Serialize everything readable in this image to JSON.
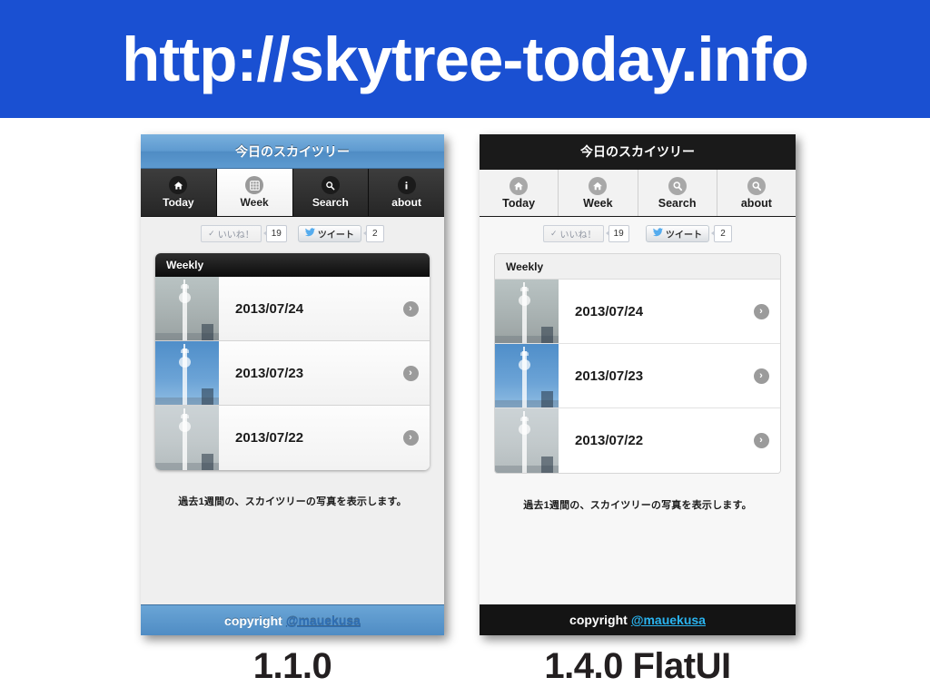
{
  "banner": {
    "title": "http://skytree-today.info",
    "background_color": "#1a50d2",
    "text_color": "#ffffff"
  },
  "mockups": [
    {
      "version_caption": "1.1.0",
      "style": "v110",
      "titlebar": {
        "text": "今日のスカイツリー",
        "background_color": "#5b9bd0",
        "text_color": "#ffffff"
      },
      "tabs": [
        {
          "label": "Today",
          "icon": "home-icon",
          "active": false
        },
        {
          "label": "Week",
          "icon": "grid-icon",
          "active": true
        },
        {
          "label": "Search",
          "icon": "search-icon",
          "active": false
        },
        {
          "label": "about",
          "icon": "info-icon",
          "active": false
        }
      ],
      "social": {
        "facebook": {
          "label": "いいね！",
          "count": "19",
          "icon": "check-icon"
        },
        "twitter": {
          "label": "ツイート",
          "count": "2",
          "icon": "twitter-bird-icon"
        }
      },
      "list": {
        "header": "Weekly",
        "rows": [
          {
            "date": "2013/07/24",
            "thumb_sky": "overcast-gray",
            "arrow": "chevron-right-icon"
          },
          {
            "date": "2013/07/23",
            "thumb_sky": "clear-blue",
            "arrow": "chevron-right-icon"
          },
          {
            "date": "2013/07/22",
            "thumb_sky": "hazy-pale",
            "arrow": "chevron-right-icon"
          }
        ]
      },
      "description": "過去1週間の、スカイツリーの写真を表示します。",
      "footer": {
        "text": "copyright",
        "handle": "@mauekusa",
        "background_color": "#5b9bd0"
      }
    },
    {
      "version_caption": "1.4.0 FlatUI",
      "style": "vflat",
      "titlebar": {
        "text": "今日のスカイツリー",
        "background_color": "#1a1a1a",
        "text_color": "#ffffff"
      },
      "tabs": [
        {
          "label": "Today",
          "icon": "home-icon",
          "active": false
        },
        {
          "label": "Week",
          "icon": "home-icon",
          "active": false
        },
        {
          "label": "Search",
          "icon": "search-icon",
          "active": false
        },
        {
          "label": "about",
          "icon": "search-icon",
          "active": false
        }
      ],
      "social": {
        "facebook": {
          "label": "いいね！",
          "count": "19",
          "icon": "check-icon"
        },
        "twitter": {
          "label": "ツイート",
          "count": "2",
          "icon": "twitter-bird-icon"
        }
      },
      "list": {
        "header": "Weekly",
        "rows": [
          {
            "date": "2013/07/24",
            "thumb_sky": "overcast-gray",
            "arrow": "chevron-right-icon"
          },
          {
            "date": "2013/07/23",
            "thumb_sky": "clear-blue",
            "arrow": "chevron-right-icon"
          },
          {
            "date": "2013/07/22",
            "thumb_sky": "hazy-pale",
            "arrow": "chevron-right-icon"
          }
        ]
      },
      "description": "過去1週間の、スカイツリーの写真を表示します。",
      "footer": {
        "text": "copyright",
        "handle": "@mauekusa",
        "background_color": "#141414"
      }
    }
  ]
}
